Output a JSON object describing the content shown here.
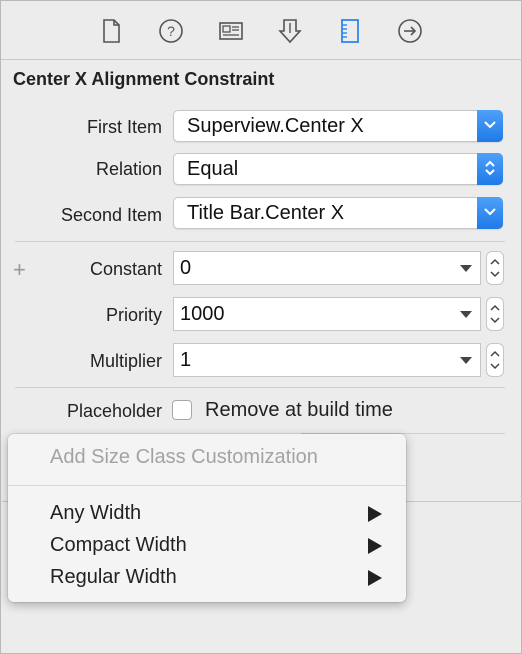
{
  "toolbar": {
    "tabs": [
      {
        "icon": "file-inspector-icon"
      },
      {
        "icon": "quick-help-icon"
      },
      {
        "icon": "identity-inspector-icon"
      },
      {
        "icon": "attributes-inspector-icon"
      },
      {
        "icon": "size-inspector-icon"
      },
      {
        "icon": "connections-inspector-icon"
      }
    ],
    "accent": "#2f86e8"
  },
  "inspector": {
    "title": "Center X Alignment Constraint",
    "first_item": {
      "label": "First Item",
      "value": "Superview.Center X"
    },
    "relation": {
      "label": "Relation",
      "value": "Equal"
    },
    "second_item": {
      "label": "Second Item",
      "value": "Title Bar.Center X"
    },
    "constant": {
      "label": "Constant",
      "value": "0"
    },
    "priority": {
      "label": "Priority",
      "value": "1000"
    },
    "multiplier": {
      "label": "Multiplier",
      "value": "1"
    },
    "placeholder": {
      "label": "Placeholder",
      "checkbox_label": "Remove at build time",
      "checked": false
    },
    "add_variation_symbol": "+"
  },
  "context_menu": {
    "header": "Add Size Class Customization",
    "items": [
      {
        "label": "Any Width"
      },
      {
        "label": "Compact Width"
      },
      {
        "label": "Regular Width"
      }
    ]
  }
}
